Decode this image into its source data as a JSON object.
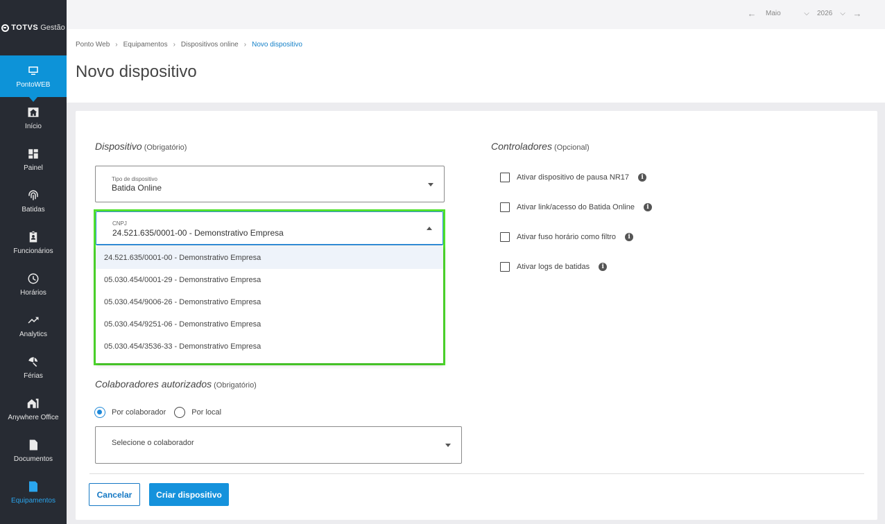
{
  "app": {
    "brand": "TOTVS",
    "brand_sub": "Gestão"
  },
  "sidebar": {
    "active": {
      "label": "PontoWEB",
      "icon": "monitor-icon"
    },
    "items": [
      {
        "label": "Início",
        "icon": "home-icon"
      },
      {
        "label": "Painel",
        "icon": "dashboard-icon"
      },
      {
        "label": "Batidas",
        "icon": "fingerprint-icon"
      },
      {
        "label": "Funcionários",
        "icon": "badge-icon"
      },
      {
        "label": "Horários",
        "icon": "clock-icon"
      },
      {
        "label": "Analytics",
        "icon": "trending-icon"
      },
      {
        "label": "Férias",
        "icon": "beach-icon"
      },
      {
        "label": "Anywhere Office",
        "icon": "house-office-icon"
      },
      {
        "label": "Documentos",
        "icon": "document-icon"
      },
      {
        "label": "Equipamentos",
        "icon": "device-icon"
      }
    ]
  },
  "topbar": {
    "month": "Maio",
    "year": "2026"
  },
  "breadcrumb": [
    "Ponto Web",
    "Equipamentos",
    "Dispositivos online",
    "Novo dispositivo"
  ],
  "page": {
    "title": "Novo dispositivo"
  },
  "dispositivo": {
    "title": "Dispositivo",
    "required": "(Obrigatório)",
    "tipo": {
      "label": "Tipo de dispositivo",
      "value": "Batida Online"
    },
    "cnpj": {
      "label": "CNPJ",
      "value": "24.521.635/0001-00 - Demonstrativo Empresa",
      "options": [
        "24.521.635/0001-00 - Demonstrativo Empresa",
        "05.030.454/0001-29 - Demonstrativo Empresa",
        "05.030.454/9006-26 - Demonstrativo Empresa",
        "05.030.454/9251-06 - Demonstrativo Empresa",
        "05.030.454/3536-33 - Demonstrativo Empresa"
      ]
    }
  },
  "colaboradores": {
    "title": "Colaboradores autorizados",
    "required": "(Obrigatório)",
    "radio_colaborador": "Por colaborador",
    "radio_local": "Por local",
    "select_placeholder": "Selecione o colaborador"
  },
  "controladores": {
    "title": "Controladores",
    "optional": "(Opcional)",
    "checks": [
      "Ativar dispositivo de pausa NR17",
      "Ativar link/acesso do Batida Online",
      "Ativar fuso horário como filtro",
      "Ativar logs de batidas"
    ]
  },
  "actions": {
    "cancel": "Cancelar",
    "create": "Criar dispositivo"
  },
  "colors": {
    "accent": "#1592dc",
    "sidebar": "#272b33",
    "highlight": "#4fe12c"
  }
}
